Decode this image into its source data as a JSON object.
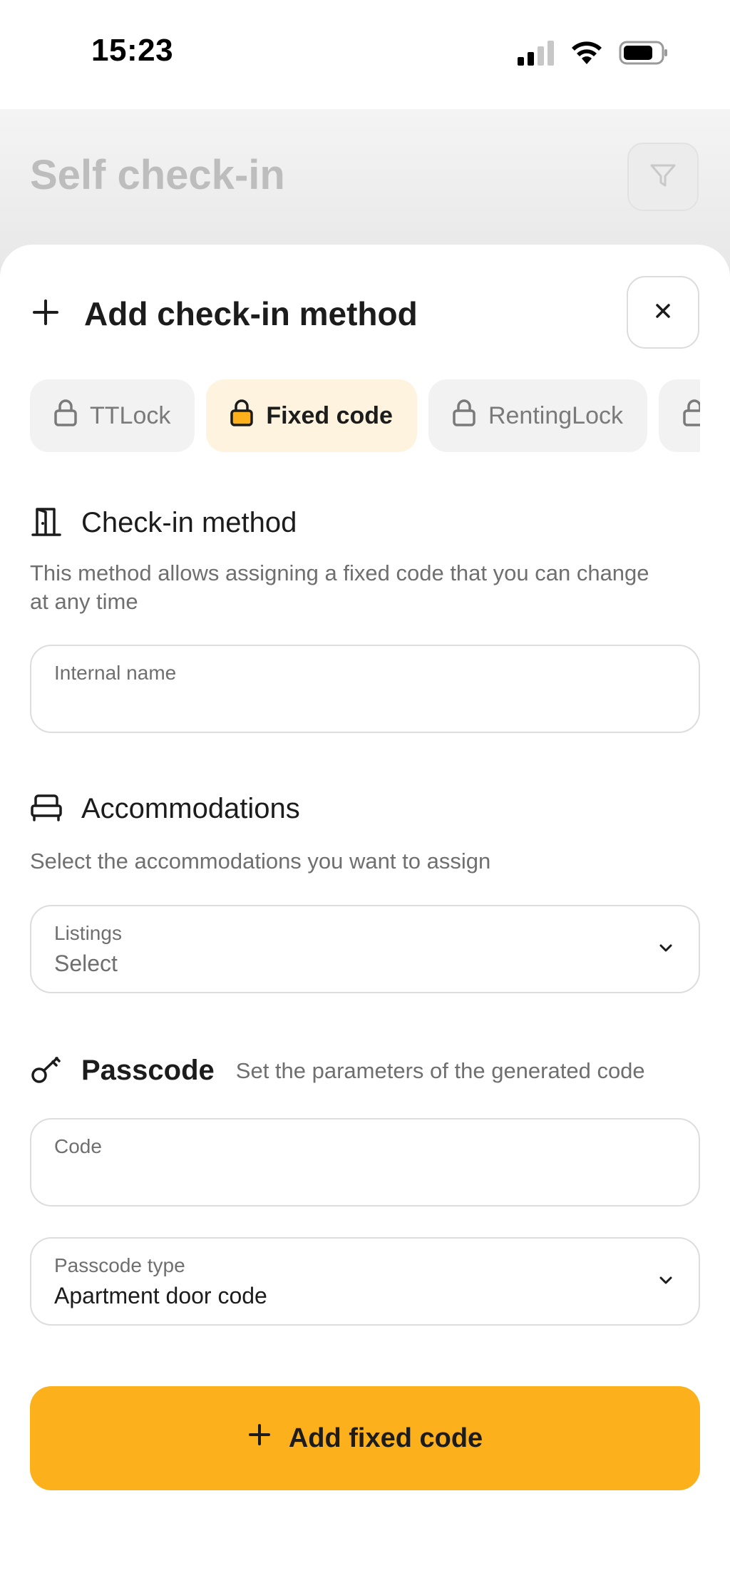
{
  "status_bar": {
    "time": "15:23",
    "icons": [
      "cellular-signal-icon",
      "wifi-icon",
      "battery-icon"
    ]
  },
  "background_page": {
    "title": "Self check-in",
    "filter_icon": "filter-icon"
  },
  "sheet": {
    "title": "Add check-in method",
    "title_icon": "plus-icon",
    "close_icon": "close-icon"
  },
  "tabs": [
    {
      "label": "TTLock",
      "icon": "lock-icon",
      "active": false
    },
    {
      "label": "Fixed code",
      "icon": "lock-icon",
      "active": true
    },
    {
      "label": "RentingLock",
      "icon": "lock-icon",
      "active": false
    },
    {
      "label": "",
      "icon": "lock-icon",
      "active": false
    }
  ],
  "checkin_section": {
    "icon": "door-icon",
    "title": "Check-in method",
    "description": "This method allows assigning a fixed code that you can change at any time",
    "internal_name": {
      "label": "Internal name",
      "value": ""
    }
  },
  "accommodations_section": {
    "icon": "bed-icon",
    "title": "Accommodations",
    "description": "Select the accommodations you want to assign",
    "listings": {
      "label": "Listings",
      "value": "Select"
    }
  },
  "passcode_section": {
    "icon": "key-icon",
    "title": "Passcode",
    "description": "Set the parameters of the generated code",
    "code": {
      "label": "Code",
      "value": ""
    },
    "passcode_type": {
      "label": "Passcode type",
      "value": "Apartment door code"
    }
  },
  "primary_action": {
    "label": "Add fixed code",
    "icon": "plus-icon"
  },
  "colors": {
    "accent": "#fbb01c",
    "active_tab_bg": "#fdf3de"
  }
}
